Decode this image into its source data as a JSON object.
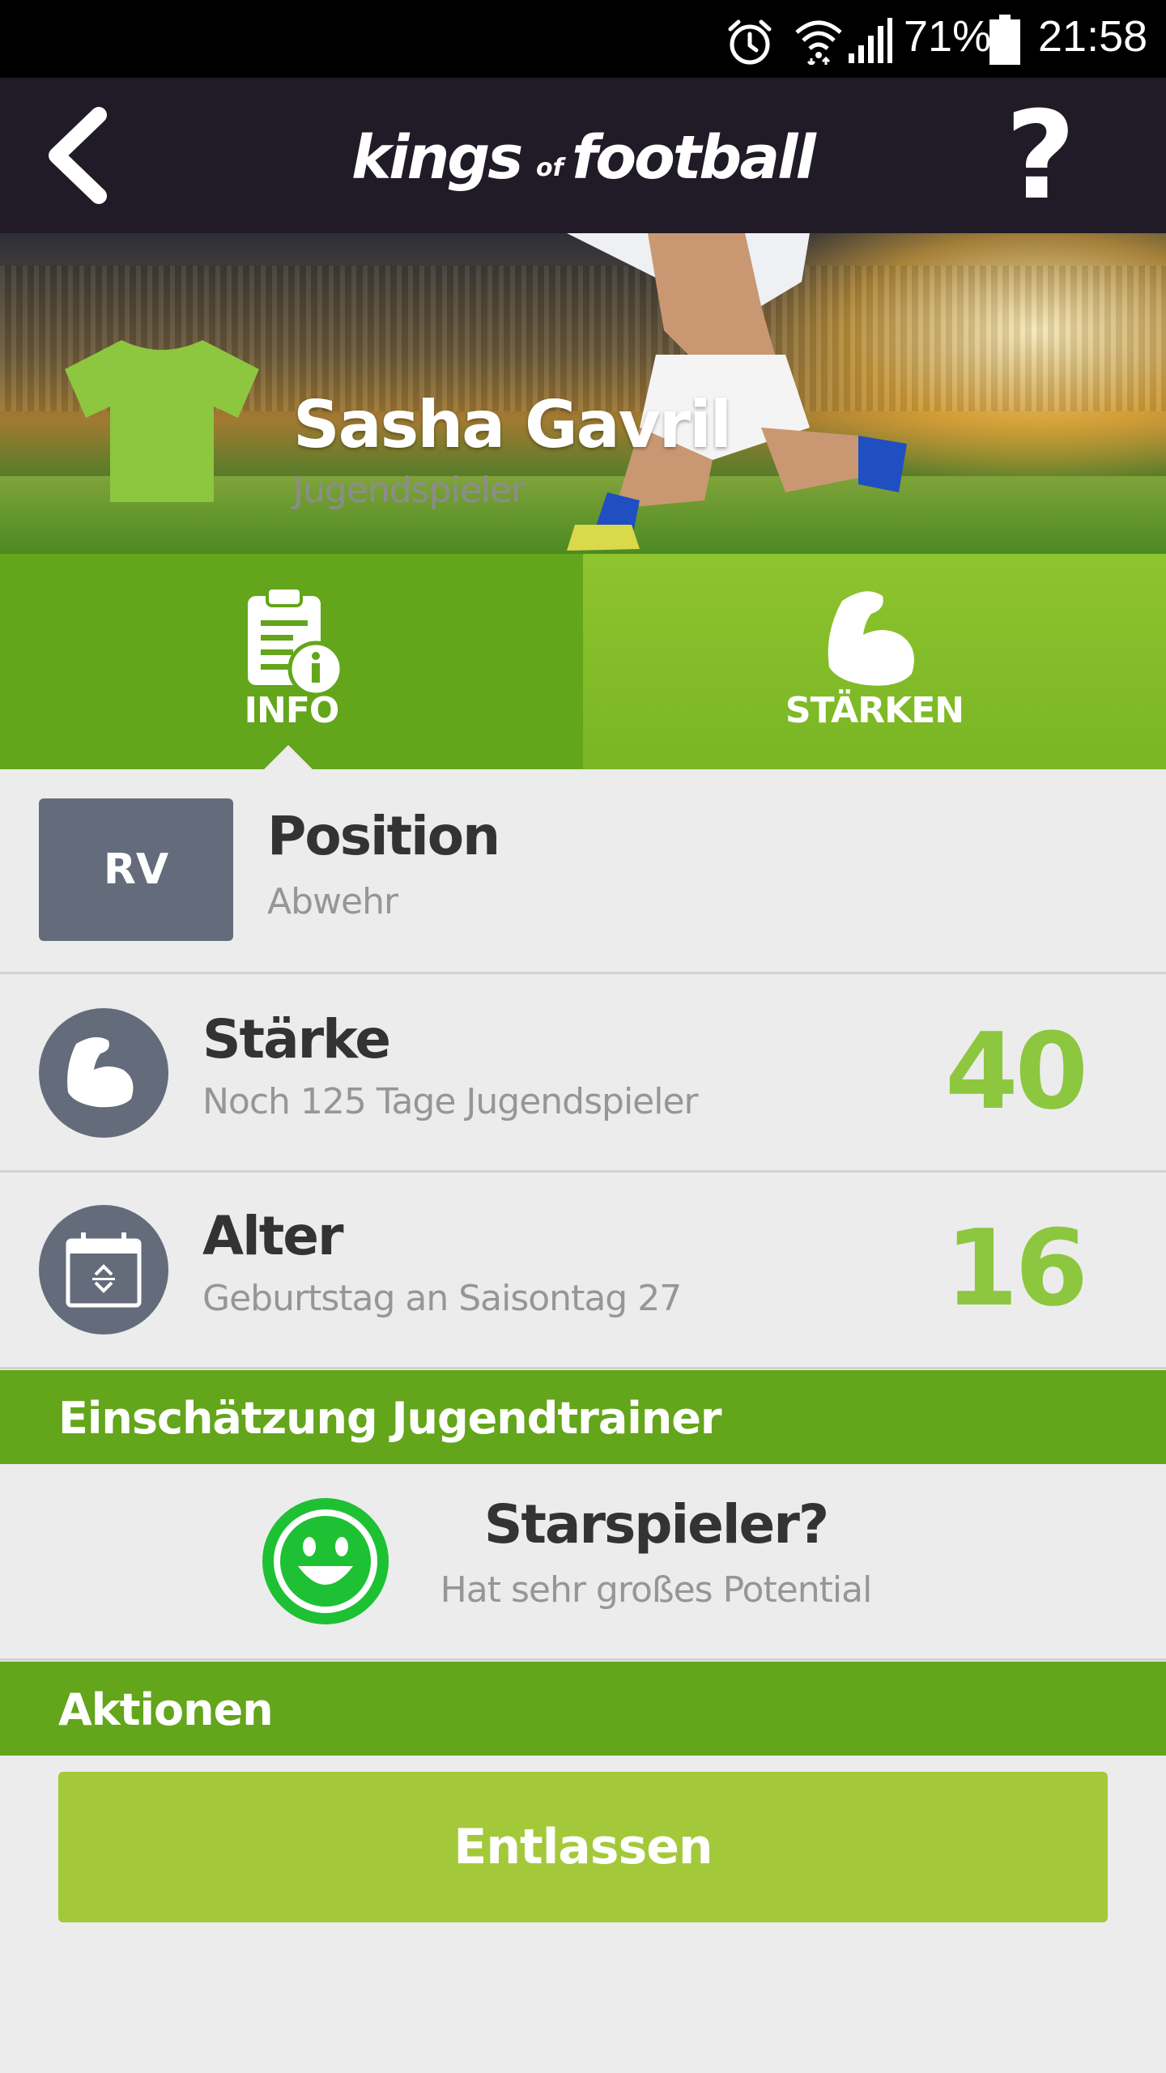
{
  "status_bar": {
    "battery": "71%",
    "time": "21:58",
    "icons": [
      "alarm-icon",
      "wifi-icon",
      "signal-icon",
      "battery-icon"
    ]
  },
  "header": {
    "logo_kings": "kings",
    "logo_of": "of",
    "logo_football": "football",
    "help_label": "?"
  },
  "hero": {
    "player_name": "Sasha Gavril",
    "player_role": "Jugendspieler",
    "shirt_color": "#8dc63f"
  },
  "tabs": [
    {
      "label": "INFO",
      "icon": "document-info-icon",
      "active": true
    },
    {
      "label": "STÄRKEN",
      "icon": "muscle-arm-icon",
      "active": false
    }
  ],
  "position": {
    "badge": "RV",
    "title": "Position",
    "subtitle": "Abwehr"
  },
  "strength": {
    "title": "Stärke",
    "subtitle": "Noch 125 Tage Jugendspieler",
    "value": "40"
  },
  "age": {
    "title": "Alter",
    "subtitle": "Geburtstag an Saisontag 27",
    "value": "16"
  },
  "assessment": {
    "section_title": "Einschätzung Jugendtrainer",
    "title": "Starspieler?",
    "subtitle": "Hat sehr großes Potential",
    "icon": "smiley-icon"
  },
  "actions": {
    "section_title": "Aktionen",
    "dismiss_label": "Entlassen"
  },
  "colors": {
    "header_bg": "#201b27",
    "green_dark": "#63a51b",
    "green_light": "#8dc63f",
    "button_green": "#a3c93a",
    "badge_gray": "#646c7b",
    "smiley_green": "#1dc133"
  }
}
